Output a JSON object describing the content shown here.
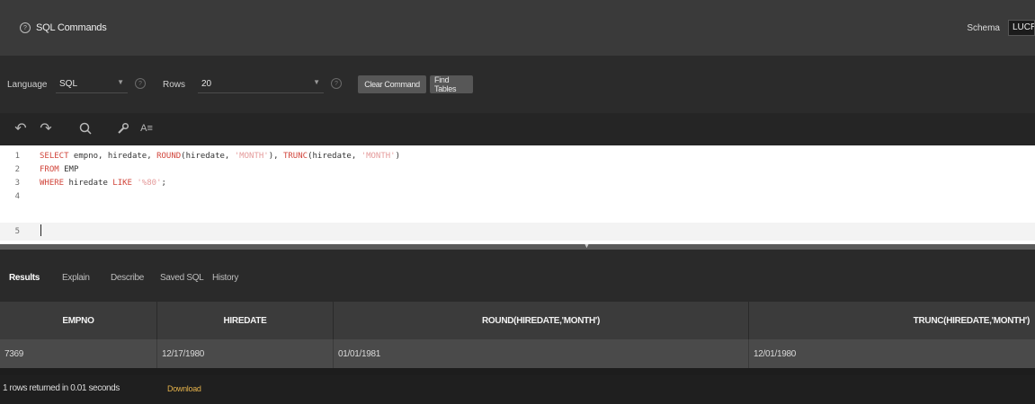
{
  "app": {
    "title": "SQL Commands"
  },
  "schema": {
    "label": "Schema",
    "value": "LUCR"
  },
  "options": {
    "language_label": "Language",
    "language_value": "SQL",
    "rows_label": "Rows",
    "rows_value": "20",
    "clear_command": "Clear Command",
    "find_tables": "Find Tables"
  },
  "toolbar": {
    "icons": [
      "undo-icon",
      "redo-icon",
      "search-icon",
      "wrench-icon",
      "format-icon"
    ],
    "format_label": "A≡"
  },
  "editor": {
    "lines": [
      {
        "num": "1",
        "tokens": [
          {
            "t": "SELECT",
            "c": "kw"
          },
          {
            "t": " empno, hiredate, ",
            "c": ""
          },
          {
            "t": "ROUND",
            "c": "kw"
          },
          {
            "t": "(hiredate, ",
            "c": ""
          },
          {
            "t": "'MONTH'",
            "c": "str"
          },
          {
            "t": "), ",
            "c": ""
          },
          {
            "t": "TRUNC",
            "c": "kw"
          },
          {
            "t": "(hiredate, ",
            "c": ""
          },
          {
            "t": "'MONTH'",
            "c": "str"
          },
          {
            "t": ")",
            "c": ""
          }
        ]
      },
      {
        "num": "2",
        "tokens": [
          {
            "t": "FROM",
            "c": "kw"
          },
          {
            "t": " EMP",
            "c": ""
          }
        ]
      },
      {
        "num": "3",
        "tokens": [
          {
            "t": "WHERE",
            "c": "kw"
          },
          {
            "t": " hiredate ",
            "c": ""
          },
          {
            "t": "LIKE",
            "c": "kw"
          },
          {
            "t": " ",
            "c": ""
          },
          {
            "t": "'%80'",
            "c": "str"
          },
          {
            "t": ";",
            "c": ""
          }
        ]
      },
      {
        "num": "4",
        "tokens": []
      },
      {
        "num": "5",
        "tokens": []
      }
    ]
  },
  "results_tabs": [
    "Results",
    "Explain",
    "Describe",
    "Saved SQL",
    "History"
  ],
  "table": {
    "columns": [
      "EMPNO",
      "HIREDATE",
      "ROUND(HIREDATE,'MONTH')",
      "TRUNC(HIREDATE,'MONTH')"
    ],
    "rows": [
      [
        "7369",
        "12/17/1980",
        "01/01/1981",
        "12/01/1980"
      ]
    ]
  },
  "footer": {
    "status": "1 rows returned in 0.01 seconds",
    "download": "Download"
  }
}
